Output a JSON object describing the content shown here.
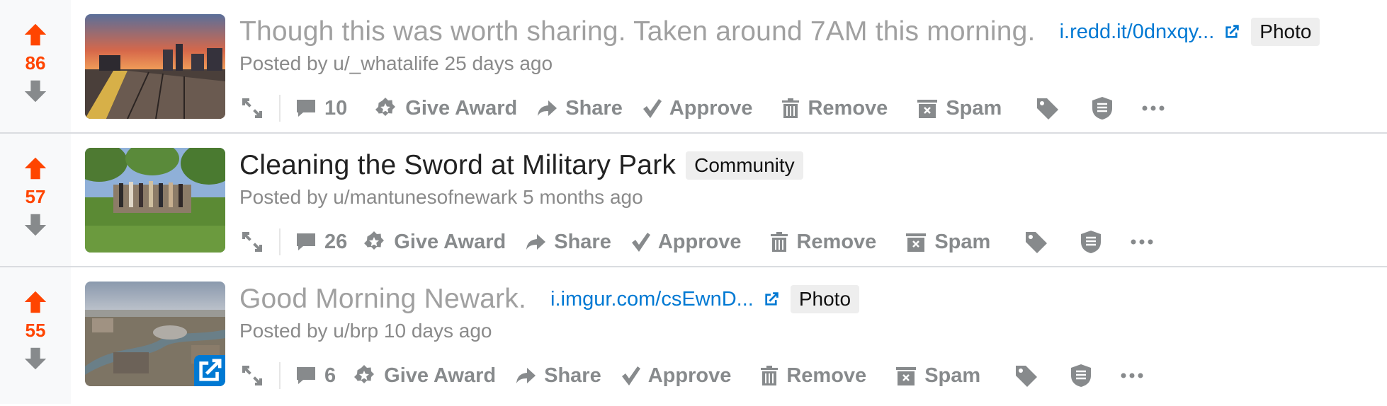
{
  "posts": [
    {
      "score": "86",
      "title": "Though this was worth sharing. Taken around 7AM this morning.",
      "title_visited": true,
      "domain": "i.redd.it/0dnxqy...",
      "flair": "Photo",
      "meta": "Posted by u/_whatalife 25 days ago",
      "comments": "10"
    },
    {
      "score": "57",
      "title": "Cleaning the Sword at Military Park",
      "title_visited": false,
      "domain": "",
      "flair": "Community",
      "meta": "Posted by u/mantunesofnewark 5 months ago",
      "comments": "26"
    },
    {
      "score": "55",
      "title": "Good Morning Newark.",
      "title_visited": true,
      "domain": "i.imgur.com/csEwnD...",
      "flair": "Photo",
      "meta": "Posted by u/brp 10 days ago",
      "comments": "6"
    }
  ],
  "actions": {
    "give_award": "Give Award",
    "share": "Share",
    "approve": "Approve",
    "remove": "Remove",
    "spam": "Spam"
  },
  "icons": [
    "upvote-icon",
    "downvote-icon",
    "expand-icon",
    "comment-icon",
    "award-icon",
    "share-icon",
    "check-icon",
    "trash-icon",
    "spam-icon",
    "tag-icon",
    "shield-icon",
    "more-icon",
    "external-link-icon"
  ],
  "colors": {
    "upvote": "#ff4500",
    "link": "#0079d3",
    "action": "#878a8c"
  }
}
